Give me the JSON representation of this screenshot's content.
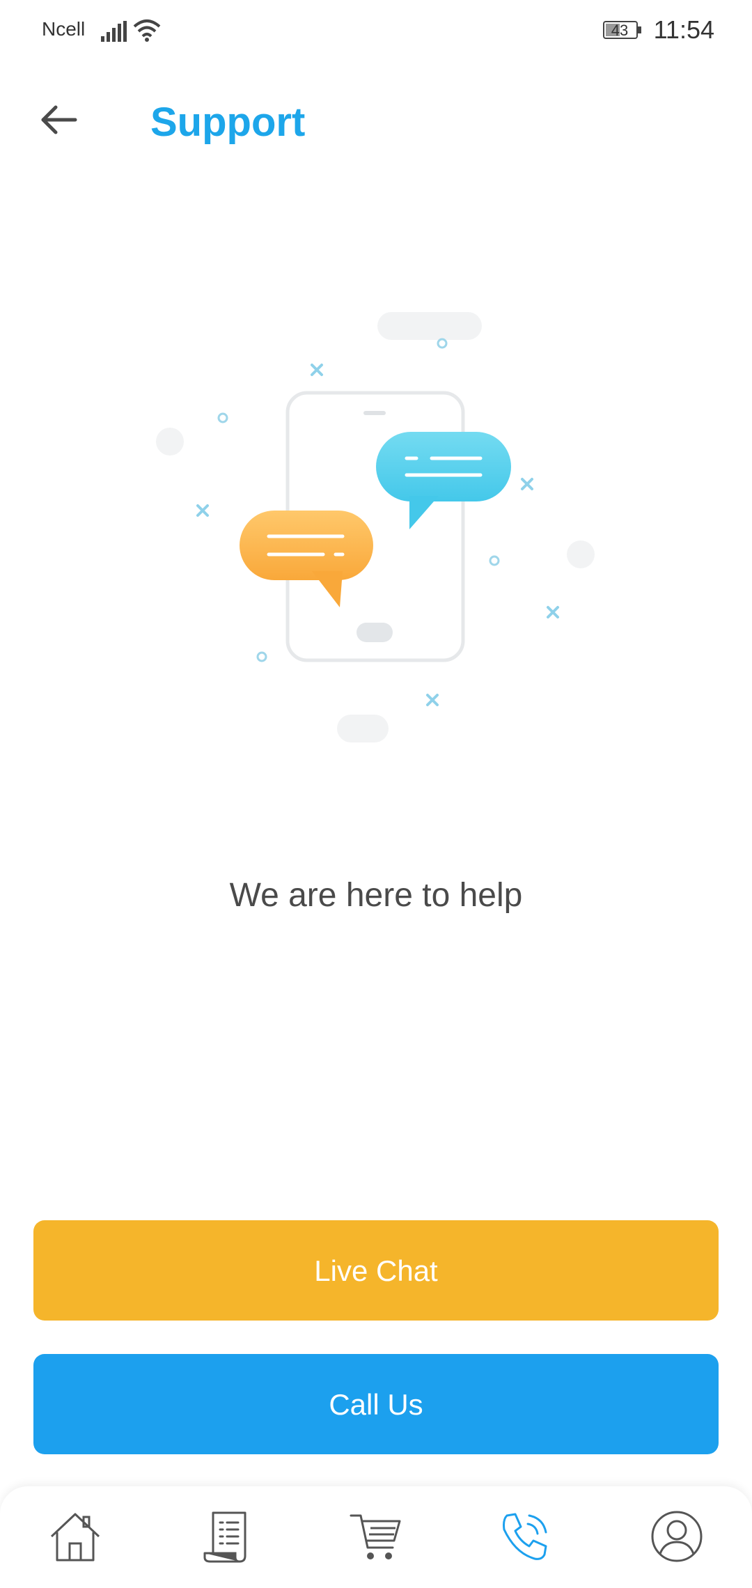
{
  "status_bar": {
    "carrier": "Ncell",
    "battery": "43",
    "time": "11:54"
  },
  "header": {
    "title": "Support",
    "back_icon": "arrow-left-icon"
  },
  "main": {
    "illustration": "chat-bubbles-on-phone-illustration",
    "helper_text": "We are here to help"
  },
  "actions": {
    "live_chat_label": "Live Chat",
    "call_us_label": "Call Us"
  },
  "bottom_nav": {
    "items": [
      {
        "icon": "home-icon"
      },
      {
        "icon": "orders-receipt-icon"
      },
      {
        "icon": "cart-icon"
      },
      {
        "icon": "phone-call-icon",
        "active": true
      },
      {
        "icon": "profile-icon"
      }
    ]
  },
  "colors": {
    "accent": "#1da6ea",
    "live_chat": "#f5b52b",
    "call_us": "#1ca0ee",
    "text": "#4a4a4a",
    "nav_icon": "#555555"
  }
}
